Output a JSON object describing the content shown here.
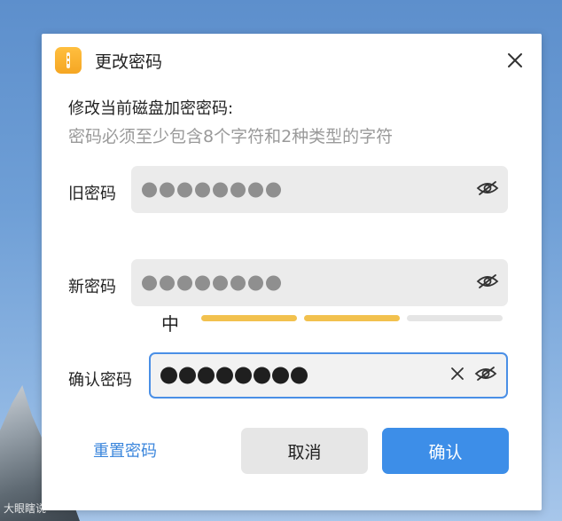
{
  "dialog": {
    "title": "更改密码",
    "description": "修改当前磁盘加密密码:",
    "hint": "密码必须至少包含8个字符和2种类型的字符"
  },
  "fields": {
    "old": {
      "label": "旧密码",
      "dot_count": 8
    },
    "new": {
      "label": "新密码",
      "dot_count": 8
    },
    "confirm": {
      "label": "确认密码",
      "dot_count": 8
    }
  },
  "strength": {
    "label": "中",
    "level": 2,
    "total_levels": 3,
    "filled_color": "#f2c14e",
    "empty_color": "#e5e5e5"
  },
  "buttons": {
    "reset": "重置密码",
    "cancel": "取消",
    "confirm": "确认"
  },
  "watermark": "大眼瞎说",
  "colors": {
    "accent": "#3d8ee8",
    "app_icon": "#f5a623"
  }
}
